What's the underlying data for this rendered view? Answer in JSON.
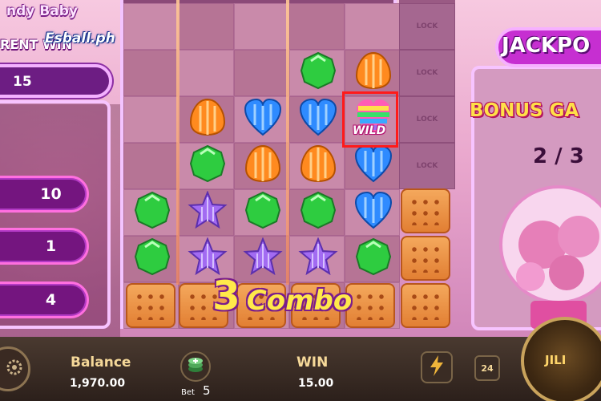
{
  "header": {
    "game_title": "ndy Baby",
    "brand_logo": "Esball.ph",
    "current_win_label": "RENT WIN",
    "current_win_value": "15"
  },
  "multipliers": {
    "values": [
      "10",
      "1",
      "4"
    ]
  },
  "grid": {
    "lock_label": "LOCK",
    "wild_label": "WILD",
    "combo_number": "3",
    "combo_text": "Combo",
    "candies": [
      {
        "type": "candy-green",
        "col": 3,
        "row": 1
      },
      {
        "type": "candy-orange",
        "col": 4,
        "row": 1
      },
      {
        "type": "candy-orange",
        "col": 1,
        "row": 2
      },
      {
        "type": "candy-blue-heart",
        "col": 2,
        "row": 2
      },
      {
        "type": "candy-blue-heart",
        "col": 3,
        "row": 2
      },
      {
        "type": "candy-wild-rainbow",
        "col": 4,
        "row": 2
      },
      {
        "type": "candy-green",
        "col": 1,
        "row": 3
      },
      {
        "type": "candy-orange",
        "col": 2,
        "row": 3
      },
      {
        "type": "candy-orange",
        "col": 3,
        "row": 3
      },
      {
        "type": "candy-blue-heart",
        "col": 4,
        "row": 3
      },
      {
        "type": "candy-green",
        "col": 0,
        "row": 4
      },
      {
        "type": "candy-purple-star",
        "col": 1,
        "row": 4
      },
      {
        "type": "candy-green",
        "col": 2,
        "row": 4
      },
      {
        "type": "candy-green",
        "col": 3,
        "row": 4
      },
      {
        "type": "candy-blue-heart",
        "col": 4,
        "row": 4
      },
      {
        "type": "candy-green",
        "col": 0,
        "row": 5
      },
      {
        "type": "candy-purple-star",
        "col": 1,
        "row": 5
      },
      {
        "type": "candy-purple-star",
        "col": 2,
        "row": 5
      },
      {
        "type": "candy-purple-star",
        "col": 3,
        "row": 5
      },
      {
        "type": "candy-green",
        "col": 4,
        "row": 5
      }
    ]
  },
  "jackpot": {
    "title": "JACKPO",
    "bonus_title": "BONUS GA",
    "bonus_count": "2 / 3"
  },
  "bottom_bar": {
    "balance_label": "Balance",
    "balance_value": "1,970.00",
    "bet_label": "Bet",
    "bet_value": "5",
    "win_label": "WIN",
    "win_value": "15.00",
    "auto_count": "24",
    "spin_logo": "JILI"
  },
  "colors": {
    "frame": "#f3c4ff",
    "accent_purple": "#74157f",
    "combo_yellow": "#ffe94a",
    "wild_highlight": "#ff1a1a"
  }
}
